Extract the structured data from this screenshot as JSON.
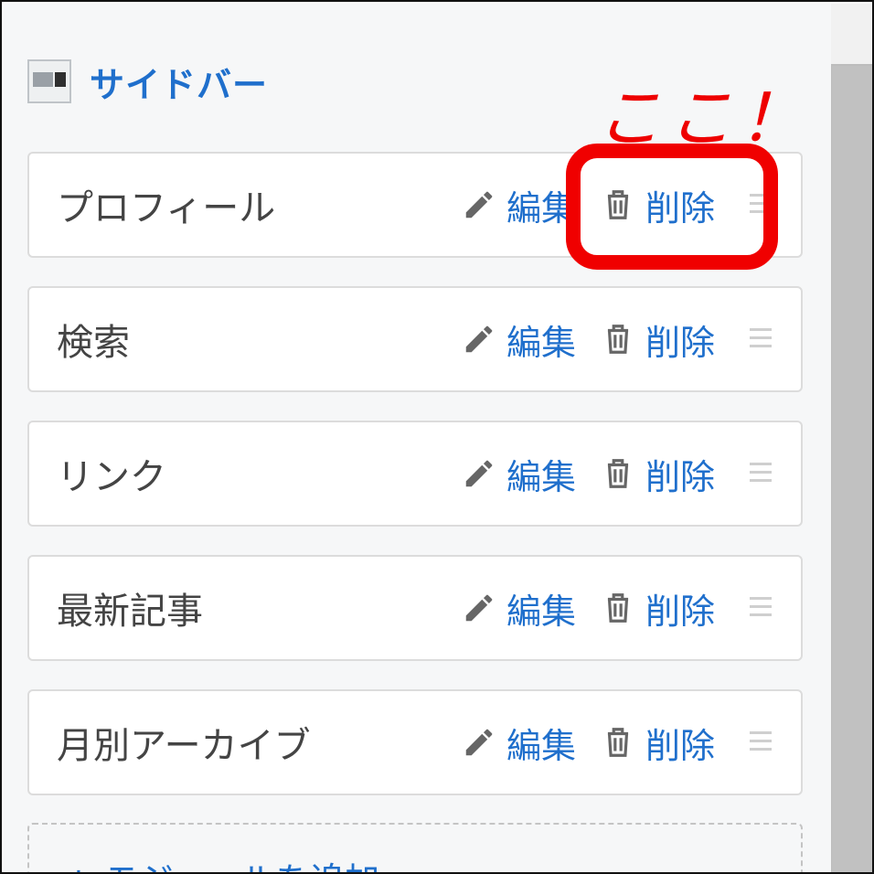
{
  "sidebar": {
    "title": "サイドバー",
    "icon": "sidebar-layout-icon"
  },
  "widgets": [
    {
      "name": "プロフィール",
      "edit_label": "編集",
      "delete_label": "削除"
    },
    {
      "name": "検索",
      "edit_label": "編集",
      "delete_label": "削除"
    },
    {
      "name": "リンク",
      "edit_label": "編集",
      "delete_label": "削除"
    },
    {
      "name": "最新記事",
      "edit_label": "編集",
      "delete_label": "削除"
    },
    {
      "name": "月別アーカイブ",
      "edit_label": "編集",
      "delete_label": "削除"
    }
  ],
  "add_module": {
    "label": "+ モジュールを追加"
  },
  "annotation": {
    "text": "ここ！",
    "color": "#ee0000"
  },
  "colors": {
    "accent": "#1f6fcc",
    "annotation": "#f00000"
  },
  "icons": {
    "edit": "pencil-icon",
    "delete": "trash-icon",
    "drag": "drag-handle-icon"
  }
}
